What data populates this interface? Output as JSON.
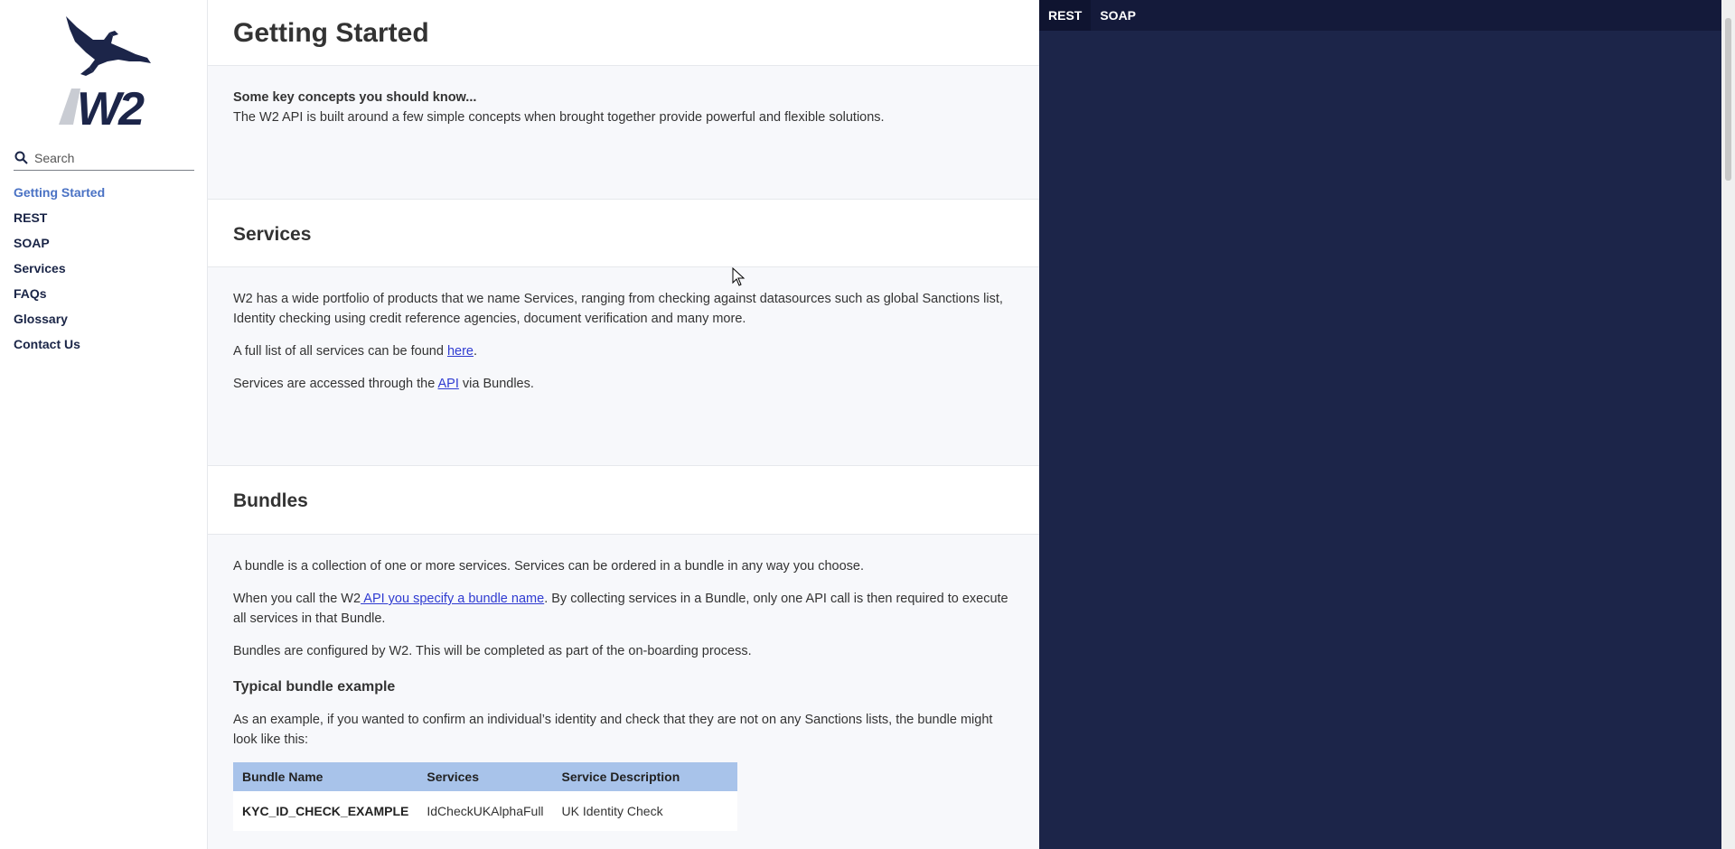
{
  "logo": {
    "text": "W2"
  },
  "search": {
    "placeholder": "Search"
  },
  "nav": {
    "items": [
      {
        "label": "Getting Started"
      },
      {
        "label": "REST"
      },
      {
        "label": "SOAP"
      },
      {
        "label": "Services"
      },
      {
        "label": "FAQs"
      },
      {
        "label": "Glossary"
      },
      {
        "label": "Contact Us"
      }
    ]
  },
  "main": {
    "title": "Getting Started",
    "intro": {
      "heading": "Some key concepts you should know...",
      "text": "The W2 API is built around a few simple concepts when brought together provide powerful and flexible solutions."
    },
    "services": {
      "title": "Services",
      "p1": "W2 has a wide portfolio of products that we name Services, ranging from checking against datasources such as global Sanctions list, Identity checking using credit reference agencies, document verification and many more.",
      "p2_before": "A full list of all services can be found ",
      "p2_link": "here",
      "p2_after": ".",
      "p3_before": "Services are accessed through the ",
      "p3_link": "API",
      "p3_after": " via Bundles."
    },
    "bundles": {
      "title": "Bundles",
      "p1": "A bundle is a collection of one or more services. Services can be ordered in a bundle in any way you choose.",
      "p2_before": "When you call the W2",
      "p2_link": " API you specify a bundle name",
      "p2_after": ". By collecting services in a Bundle, only one API call is then required to execute all services in that Bundle.",
      "p3": "Bundles are configured by W2. This will be completed as part of the on-boarding process.",
      "example_heading": "Typical bundle example",
      "example_text": "As an example, if you wanted to confirm an individual’s identity and check that they are not on any Sanctions lists, the bundle might look like this:",
      "table": {
        "headers": [
          "Bundle Name",
          "Services",
          "Service Description"
        ],
        "rows": [
          [
            "KYC_ID_CHECK_EXAMPLE",
            "IdCheckUKAlphaFull",
            "UK Identity Check"
          ]
        ]
      }
    }
  },
  "code_panel": {
    "tabs": [
      {
        "label": "REST",
        "active": true
      },
      {
        "label": "SOAP",
        "active": false
      }
    ]
  },
  "colors": {
    "nav_active": "#4a72c4",
    "nav_text": "#1a2547",
    "code_bg": "#1c2549",
    "table_header": "#a8c3ea",
    "link": "#2f3bd1"
  }
}
